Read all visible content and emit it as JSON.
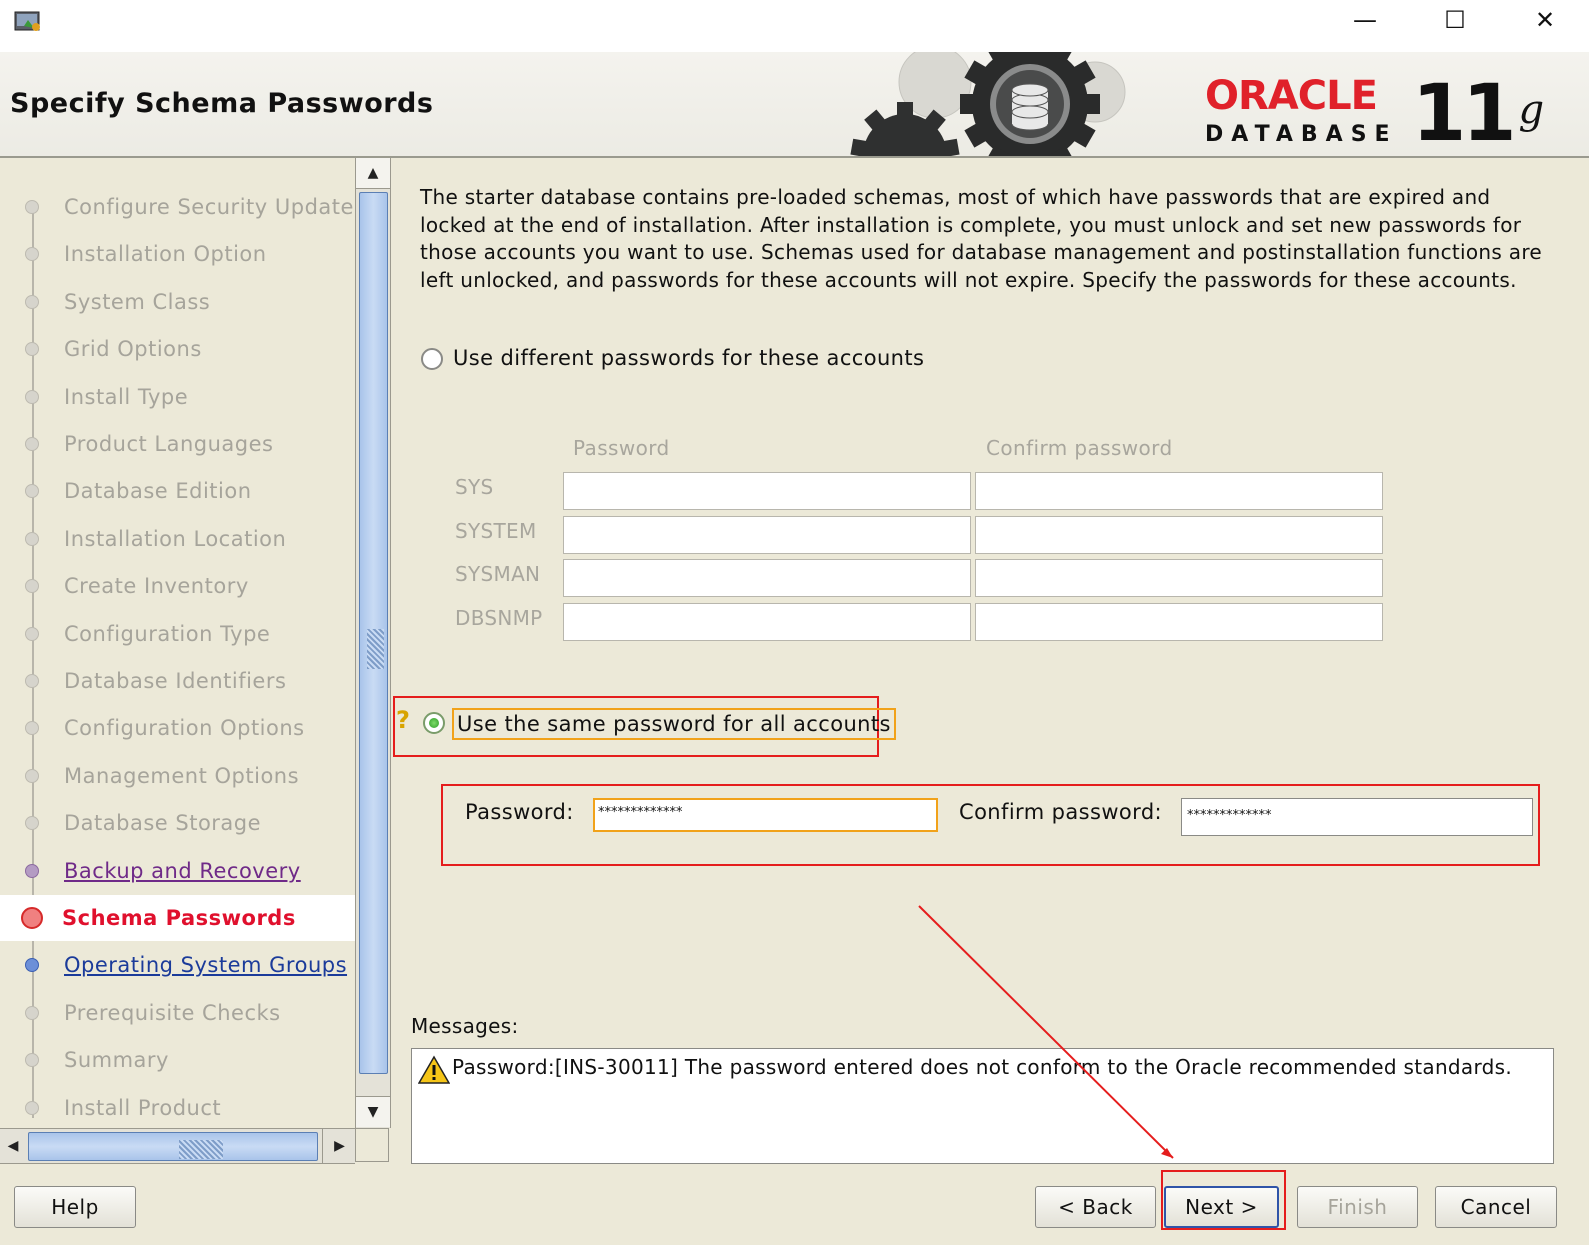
{
  "window": {
    "minimize_glyph": "—",
    "maximize_glyph": "☐",
    "close_glyph": "✕"
  },
  "header": {
    "title": "Specify Schema Passwords",
    "logo_brand": "ORACLE",
    "logo_product": "DATABASE",
    "logo_version": "11",
    "logo_version_suffix": "g"
  },
  "steps": [
    {
      "label": "Configure Security Updates",
      "state": "disabled"
    },
    {
      "label": "Installation Option",
      "state": "disabled"
    },
    {
      "label": "System Class",
      "state": "disabled"
    },
    {
      "label": "Grid Options",
      "state": "disabled"
    },
    {
      "label": "Install Type",
      "state": "disabled"
    },
    {
      "label": "Product Languages",
      "state": "disabled"
    },
    {
      "label": "Database Edition",
      "state": "disabled"
    },
    {
      "label": "Installation Location",
      "state": "disabled"
    },
    {
      "label": "Create Inventory",
      "state": "disabled"
    },
    {
      "label": "Configuration Type",
      "state": "disabled"
    },
    {
      "label": "Database Identifiers",
      "state": "disabled"
    },
    {
      "label": "Configuration Options",
      "state": "disabled"
    },
    {
      "label": "Management Options",
      "state": "disabled"
    },
    {
      "label": "Database Storage",
      "state": "disabled"
    },
    {
      "label": "Backup and Recovery",
      "state": "visited"
    },
    {
      "label": "Schema Passwords",
      "state": "current"
    },
    {
      "label": "Operating System Groups",
      "state": "link"
    },
    {
      "label": "Prerequisite Checks",
      "state": "disabled"
    },
    {
      "label": "Summary",
      "state": "disabled"
    },
    {
      "label": "Install Product",
      "state": "disabled"
    }
  ],
  "main": {
    "intro": "The starter database contains pre-loaded schemas, most of which have passwords that are expired and locked at the end of installation. After installation is complete, you must unlock and set new passwords for those accounts you want to use. Schemas used for database management and postinstallation functions are left unlocked, and passwords for these accounts will not expire. Specify the passwords for these accounts.",
    "option_different": "Use different passwords for these accounts",
    "col_password": "Password",
    "col_confirm": "Confirm password",
    "accounts": [
      {
        "name": "SYS",
        "password": "",
        "confirm": ""
      },
      {
        "name": "SYSTEM",
        "password": "",
        "confirm": ""
      },
      {
        "name": "SYSMAN",
        "password": "",
        "confirm": ""
      },
      {
        "name": "DBSNMP",
        "password": "",
        "confirm": ""
      }
    ],
    "option_same": "Use the same password for all accounts",
    "option_same_selected": true,
    "same_password_label": "Password:",
    "same_password_value": "*************",
    "same_confirm_label": "Confirm password:",
    "same_confirm_value": "*************",
    "messages_label": "Messages:",
    "message": "Password:[INS-30011] The password entered does not conform to the Oracle recommended standards."
  },
  "buttons": {
    "help": "Help",
    "back": "< Back",
    "next": "Next >",
    "finish": "Finish",
    "cancel": "Cancel"
  },
  "colors": {
    "annotation_red": "#e51d1d",
    "focus_orange": "#f1a21a",
    "current_step_red": "#e0102d",
    "oracle_red": "#e0212a"
  }
}
